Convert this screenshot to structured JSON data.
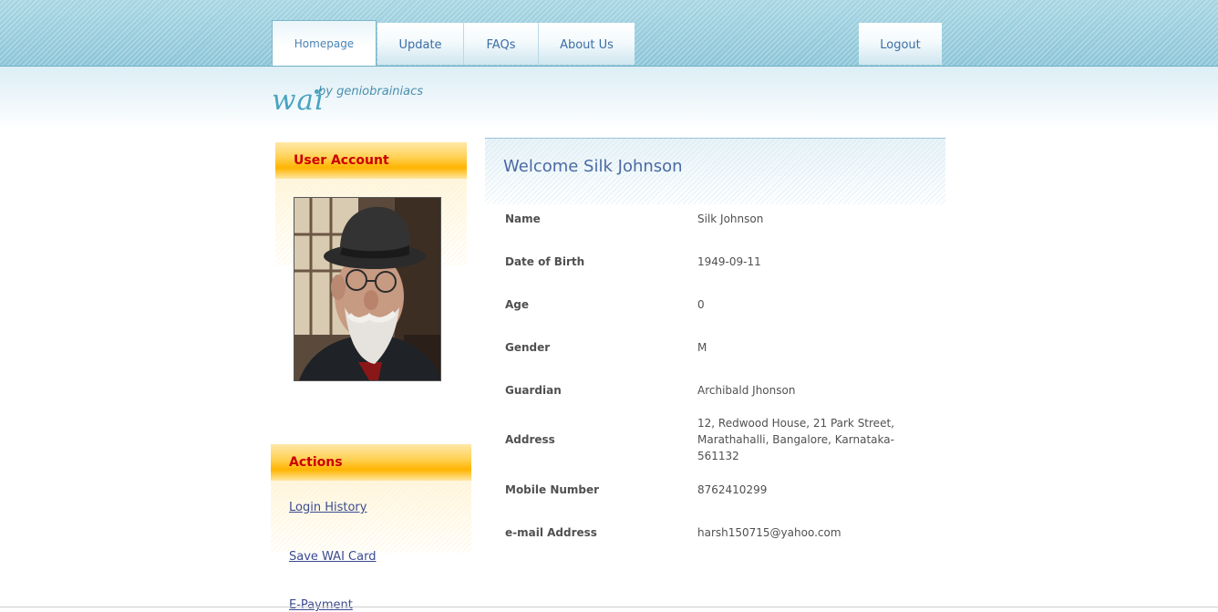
{
  "nav": {
    "tabs": [
      {
        "label": "Homepage",
        "active": true
      },
      {
        "label": "Update"
      },
      {
        "label": "FAQs"
      },
      {
        "label": "About Us"
      }
    ],
    "logout_label": "Logout"
  },
  "logo": {
    "name": "wai",
    "tagline": "by geniobrainiacs"
  },
  "user_account": {
    "title": "User Account"
  },
  "actions": {
    "title": "Actions",
    "links": [
      "Login History",
      "Save WAI Card",
      "E-Payment"
    ]
  },
  "profile": {
    "welcome": "Welcome Silk Johnson",
    "fields": [
      {
        "label": "Name",
        "value": "Silk Johnson"
      },
      {
        "label": "Date of Birth",
        "value": "1949-09-11"
      },
      {
        "label": "Age",
        "value": "0"
      },
      {
        "label": "Gender",
        "value": "M"
      },
      {
        "label": "Guardian",
        "value": "Archibald Jhonson"
      },
      {
        "label": "Address",
        "value": "12, Redwood House, 21 Park Street, Marathahalli, Bangalore, Karnataka-561132"
      },
      {
        "label": "Mobile Number",
        "value": "8762410299"
      },
      {
        "label": "e-mail Address",
        "value": "harsh150715@yahoo.com"
      }
    ]
  },
  "colors": {
    "header": "#9bcfdf",
    "tab_text": "#3d6ea6",
    "panel_title": "#cc0000",
    "panel_head": "#ffc425",
    "welcome_text": "#4a6aa3",
    "link": "#3b4b8f"
  }
}
